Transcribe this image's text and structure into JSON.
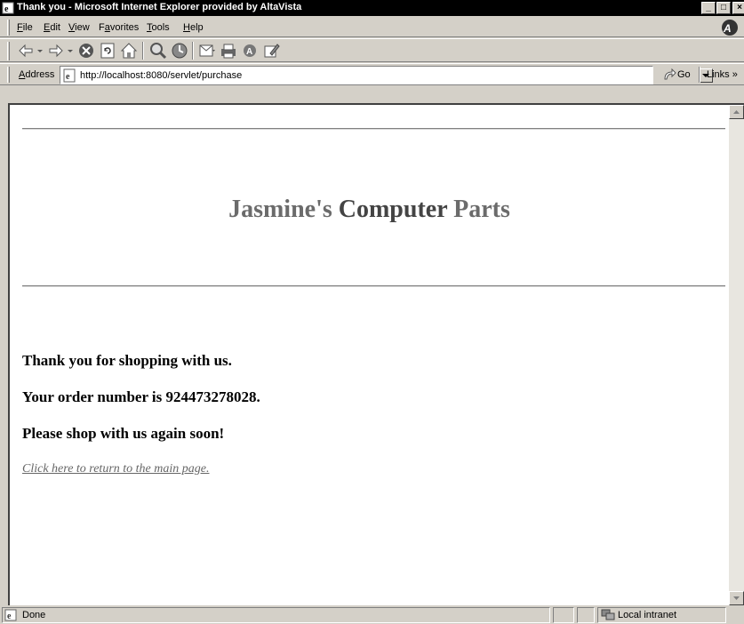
{
  "window": {
    "title": "Thank you - Microsoft Internet Explorer provided by AltaVista",
    "minimize": "_",
    "maximize": "□",
    "close": "×"
  },
  "menu": {
    "items": [
      {
        "first": "F",
        "rest": "ile"
      },
      {
        "first": "E",
        "rest": "dit"
      },
      {
        "first": "V",
        "rest": "iew"
      },
      {
        "pre": "F",
        "first": "a",
        "rest": "vorites"
      },
      {
        "first": "T",
        "rest": "ools"
      },
      {
        "first": "H",
        "rest": "elp"
      }
    ],
    "brand_icon": "altavista-logo-icon"
  },
  "toolbar": {
    "buttons": [
      "back-icon",
      "forward-icon",
      "stop-icon",
      "refresh-icon",
      "home-icon",
      "search-icon",
      "history-icon",
      "mail-icon",
      "print-icon",
      "altavista-icon",
      "edit-icon"
    ]
  },
  "address": {
    "label_first": "A",
    "label_rest": "ddress",
    "url": "http://localhost:8080/servlet/purchase",
    "go_label": "Go",
    "links_label": "Links »"
  },
  "page": {
    "title_part1": "Jasmine's ",
    "title_part2": "Computer",
    "title_part3": " Parts",
    "message1": "Thank you for shopping with us.",
    "message2": "Your order number is 924473278028.",
    "message3": "Please shop with us again soon!",
    "return_link": "Click here to return to the main page."
  },
  "status": {
    "text": "Done",
    "zone": "Local intranet"
  },
  "colors": {
    "title_grey": "#6b6b6b",
    "title_dark": "#444444",
    "link": "#666666",
    "chrome": "#d4d0c8"
  }
}
